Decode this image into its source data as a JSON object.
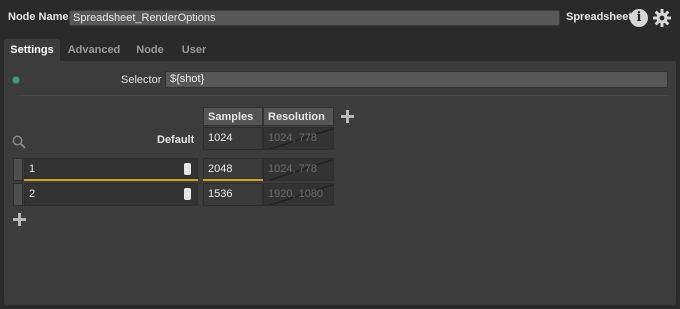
{
  "header": {
    "node_name_label": "Node Name",
    "node_name_value": "Spreadsheet_RenderOptions",
    "node_type": "Spreadsheet",
    "info_icon": "i"
  },
  "tabs": [
    {
      "label": "Settings",
      "active": true
    },
    {
      "label": "Advanced",
      "active": false
    },
    {
      "label": "Node",
      "active": false
    },
    {
      "label": "User",
      "active": false
    }
  ],
  "settings": {
    "selector_label": "Selector",
    "selector_value": "${shot}",
    "columns": [
      "Samples",
      "Resolution"
    ],
    "default_label": "Default",
    "default_row": {
      "samples": "1024",
      "resolution": "1024, 778"
    },
    "rows": [
      {
        "name": "1",
        "samples": "2048",
        "resolution": "1024, 778",
        "enabled": true
      },
      {
        "name": "2",
        "samples": "1536",
        "resolution": "1920, 1080",
        "enabled": true
      }
    ]
  },
  "colors": {
    "accent_highlight": "#c9a427",
    "status_dot": "#3fa27a"
  }
}
